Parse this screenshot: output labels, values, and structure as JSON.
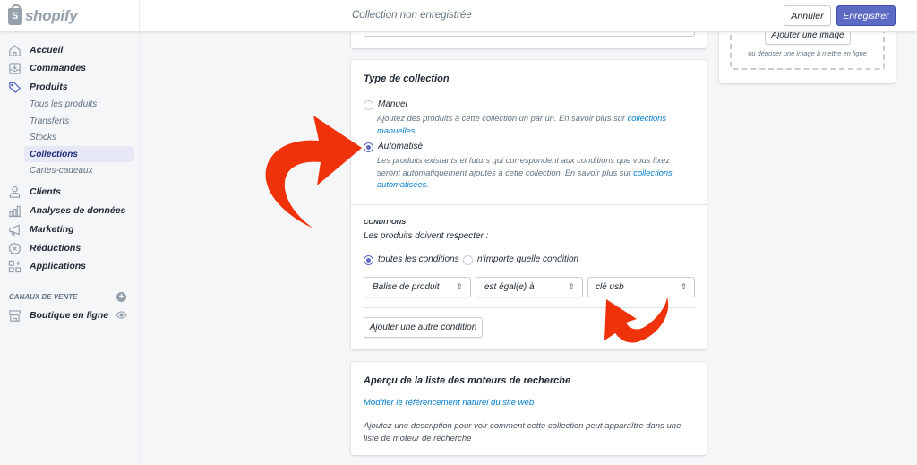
{
  "brand": {
    "name": "shopify"
  },
  "header": {
    "title": "Collection non enregistrée",
    "cancel_label": "Annuler",
    "save_label": "Enregistrer",
    "accent_color": "#5c6ac4"
  },
  "sidebar": {
    "items": [
      {
        "label": "Accueil",
        "icon": "home-icon"
      },
      {
        "label": "Commandes",
        "icon": "orders-icon"
      },
      {
        "label": "Produits",
        "icon": "tag-icon"
      },
      {
        "label": "Clients",
        "icon": "person-icon"
      },
      {
        "label": "Analyses de données",
        "icon": "bar-chart-icon"
      },
      {
        "label": "Marketing",
        "icon": "megaphone-icon"
      },
      {
        "label": "Réductions",
        "icon": "discount-icon"
      },
      {
        "label": "Applications",
        "icon": "apps-icon"
      }
    ],
    "product_subitems": [
      {
        "label": "Tous les produits",
        "selected": false
      },
      {
        "label": "Transferts",
        "selected": false
      },
      {
        "label": "Stocks",
        "selected": false
      },
      {
        "label": "Collections",
        "selected": true
      },
      {
        "label": "Cartes-cadeaux",
        "selected": false
      }
    ],
    "sales_channels": {
      "heading": "CANAUX DE VENTE",
      "items": [
        {
          "label": "Boutique en ligne",
          "icon": "store-icon"
        }
      ]
    }
  },
  "collection_type": {
    "title": "Type de collection",
    "options": [
      {
        "label": "Manuel",
        "checked": false,
        "help": "Ajoutez des produits à cette collection un par un. En savoir plus sur ",
        "link": "collections manuelles",
        "suffix": "."
      },
      {
        "label": "Automatisé",
        "checked": true,
        "help": "Les produits existants et futurs qui correspondent aux conditions que vous fixez seront automatiquement ajoutés à cette collection. En savoir plus sur ",
        "link": "collections automatisées",
        "suffix": "."
      }
    ]
  },
  "conditions": {
    "heading": "CONDITIONS",
    "subtitle": "Les produits doivent respecter :",
    "match": [
      {
        "label": "toutes les conditions",
        "checked": true
      },
      {
        "label": "n'importe quelle condition",
        "checked": false
      }
    ],
    "rule": {
      "field": "Balise de produit",
      "operator": "est égal(e) à",
      "value": "clé usb"
    },
    "add_button": "Ajouter une autre condition"
  },
  "seo": {
    "title": "Aperçu de la liste des moteurs de recherche",
    "edit_link": "Modifier le référencement naturel du site web",
    "description": "Ajoutez une description pour voir comment cette collection peut apparaître dans une liste de moteur de recherche"
  },
  "image": {
    "add_button": "Ajouter une image",
    "drop_hint": "ou déposer une image à mettre en ligne"
  },
  "annotation_color": "#f0320a"
}
